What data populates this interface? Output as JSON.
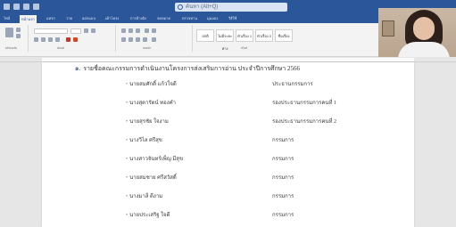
{
  "titlebar": {
    "search_text": "ค้นหา (Alt+Q)"
  },
  "menu": {
    "tabs": [
      {
        "label": "ไฟล์"
      },
      {
        "label": "หน้าแรก",
        "active": true
      },
      {
        "label": "แทรก"
      },
      {
        "label": "วาด"
      },
      {
        "label": "ออกแบบ"
      },
      {
        "label": "เค้าโครง"
      },
      {
        "label": "การอ้างอิง"
      },
      {
        "label": "จดหมาย"
      },
      {
        "label": "ตรวจทาน"
      },
      {
        "label": "มุมมอง"
      },
      {
        "label": "วิธีใช้"
      }
    ]
  },
  "ribbon": {
    "groups": [
      {
        "label": "คลิปบอร์ด"
      },
      {
        "label": "ฟอนต์"
      },
      {
        "label": "ย่อหน้า"
      },
      {
        "label": "สไตล์"
      }
    ],
    "styles": [
      "ปกติ",
      "ไม่มีระยะห่าง",
      "หัวเรื่อง 1",
      "หัวเรื่อง 2",
      "ชื่อเรื่อง"
    ]
  },
  "document": {
    "heading": "รายชื่อคณะกรรมการดำเนินงานโครงการส่งเสริมการอ่าน ประจำปีการศึกษา 2566",
    "heading_mark": "๑.",
    "rows": [
      {
        "name": "นายสมศักดิ์ แก้วใจดี",
        "role": "ประธานกรรมการ"
      },
      {
        "name": "นางสุดารัตน์ ทองคำ",
        "role": "รองประธานกรรมการคนที่ 1"
      },
      {
        "name": "นายสุรชัย ใจงาม",
        "role": "รองประธานกรรมการคนที่ 2"
      },
      {
        "name": "นางวิไล ศรีสุข",
        "role": "กรรมการ"
      },
      {
        "name": "นางสาวจันทร์เพ็ญ มีสุข",
        "role": "กรรมการ"
      },
      {
        "name": "นายสมชาย ศรีสวัสดิ์",
        "role": "กรรมการ"
      },
      {
        "name": "นางมาลี ดีงาม",
        "role": "กรรมการ"
      },
      {
        "name": "นายประเสริฐ ใจดี",
        "role": "กรรมการ"
      }
    ]
  },
  "colors": {
    "title_bar": "#2b579a",
    "ribbon": "#f3f3f3",
    "canvas": "#e6e6e6",
    "page": "#ffffff"
  }
}
